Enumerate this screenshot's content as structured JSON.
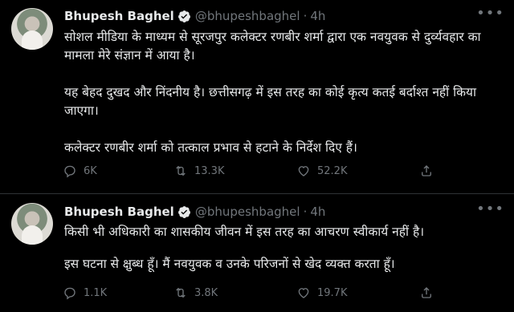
{
  "tweets": [
    {
      "author_name": "Bhupesh Baghel",
      "handle": "@bhupeshbaghel",
      "separator": "·",
      "time": "4h",
      "paragraphs": [
        "सोशल मीडिया के माध्यम से सूरजपुर कलेक्टर रणबीर शर्मा द्वारा एक नवयुवक से दुर्व्यवहार का मामला मेरे संज्ञान में आया है।",
        "यह बेहद दुखद और निंदनीय है। छत्तीसगढ़ में इस तरह का कोई कृत्य कतई बर्दाश्त नहीं किया जाएगा।",
        "कलेक्टर रणबीर शर्मा को तत्काल प्रभाव से हटाने के निर्देश दिए हैं।"
      ],
      "replies": "6K",
      "retweets": "13.3K",
      "likes": "52.2K"
    },
    {
      "author_name": "Bhupesh Baghel",
      "handle": "@bhupeshbaghel",
      "separator": "·",
      "time": "4h",
      "paragraphs": [
        "किसी भी अधिकारी का शासकीय जीवन में इस तरह का आचरण स्वीकार्य नहीं है।",
        "इस घटना से क्षुब्ध हूँ। मैं नवयुवक व उनके परिजनों से खेद व्यक्त करता हूँ।"
      ],
      "replies": "1.1K",
      "retweets": "3.8K",
      "likes": "19.7K"
    }
  ],
  "colors": {
    "background": "#000000",
    "text": "#e7e9ea",
    "muted": "#71767b",
    "verified": "#1d9bf0",
    "divider": "#2f3336"
  },
  "icons": [
    "verified-badge-icon",
    "more-icon",
    "reply-icon",
    "retweet-icon",
    "like-icon",
    "share-icon"
  ]
}
